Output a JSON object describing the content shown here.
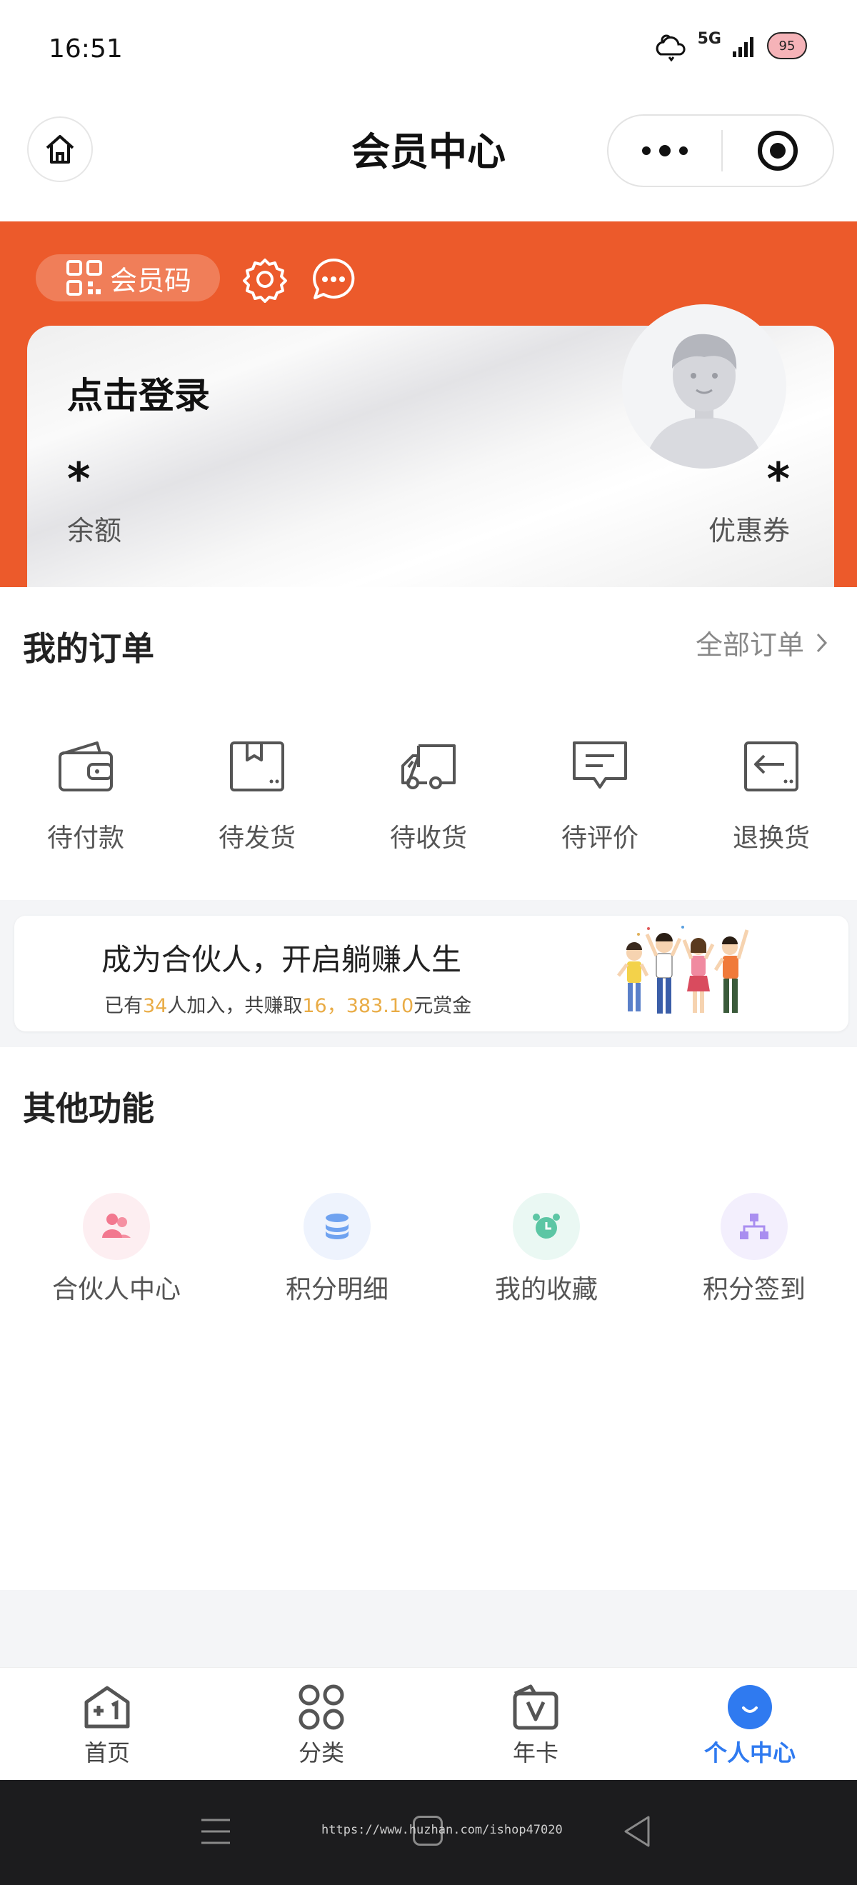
{
  "status_bar": {
    "time": "16:51",
    "network": "5G",
    "battery": "95"
  },
  "header": {
    "title": "会员中心"
  },
  "banner": {
    "member_code_label": "会员码",
    "login_text": "点击登录",
    "balance_value": "*",
    "balance_label": "余额",
    "coupon_value": "*",
    "coupon_label": "优惠券"
  },
  "orders": {
    "title": "我的订单",
    "all_label": "全部订单",
    "items": [
      {
        "label": "待付款",
        "icon": "wallet-icon"
      },
      {
        "label": "待发货",
        "icon": "package-icon"
      },
      {
        "label": "待收货",
        "icon": "truck-icon"
      },
      {
        "label": "待评价",
        "icon": "comment-icon"
      },
      {
        "label": "退换货",
        "icon": "return-icon"
      }
    ]
  },
  "partner": {
    "title": "成为合伙人，开启躺赚人生",
    "sub_prefix": "已有",
    "count": "34",
    "sub_mid": "人加入，共赚取",
    "amount": "16，383.10",
    "sub_suffix": "元赏金"
  },
  "functions": {
    "title": "其他功能",
    "items": [
      {
        "label": "合伙人中心",
        "icon": "people-icon",
        "color": "#f2788f",
        "bg": "#fdeef1"
      },
      {
        "label": "积分明细",
        "icon": "coins-icon",
        "color": "#6fa2f0",
        "bg": "#eef3fd"
      },
      {
        "label": "我的收藏",
        "icon": "alarm-clock-icon",
        "color": "#5cc6a4",
        "bg": "#eaf8f3"
      },
      {
        "label": "积分签到",
        "icon": "hierarchy-icon",
        "color": "#a98ef0",
        "bg": "#f3effd"
      }
    ]
  },
  "tabbar": {
    "items": [
      {
        "label": "首页",
        "icon": "home-tab-icon"
      },
      {
        "label": "分类",
        "icon": "category-icon"
      },
      {
        "label": "年卡",
        "icon": "annual-card-icon"
      },
      {
        "label": "个人中心",
        "icon": "profile-icon",
        "active": true
      }
    ],
    "active_color": "#2f7af0"
  },
  "watermark": "https://www.huzhan.com/ishop47020",
  "colors": {
    "brand": "#ec5a2b",
    "highlight": "#e9ac46"
  }
}
